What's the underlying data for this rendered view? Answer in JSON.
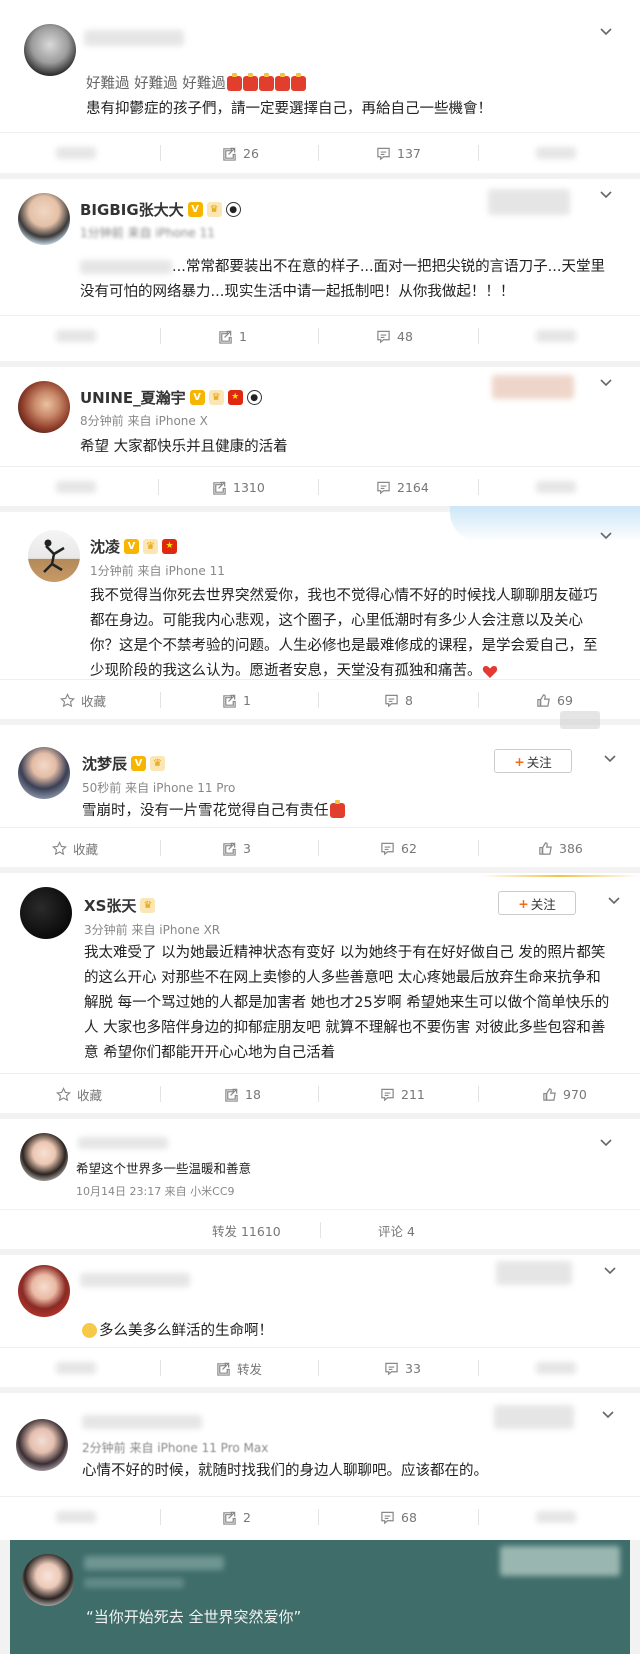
{
  "colors": {
    "accent": "#e86b0a",
    "follow_plus": "#f56b0d",
    "footer_bg": "#3e6d6a",
    "heart": "#e53935",
    "vip_badge": "#f7b500"
  },
  "posts": [
    {
      "text_line1": "好難過 好難過 好難過",
      "text_line2": "患有抑鬱症的孩子們，請一定要選擇自己，再給自己一些機會！",
      "repost": "26",
      "comment": "137"
    },
    {
      "name": "BIGBIG张大大",
      "meta": "1分钟前 来自 iPhone 11",
      "text": "...常常都要装出不在意的样子...面对一把把尖锐的言语刀子...天堂里没有可怕的网络暴力...现实生活中请一起抵制吧！从你我做起！！！",
      "repost": "1",
      "comment": "48"
    },
    {
      "name": "UNINE_夏瀚宇",
      "meta": "8分钟前 来自 iPhone X",
      "text": "希望 大家都快乐并且健康的活着",
      "repost": "1310",
      "comment": "2164"
    },
    {
      "name": "沈凌",
      "meta": "1分钟前 来自 iPhone 11",
      "text": "我不觉得当你死去世界突然爱你，我也不觉得心情不好的时候找人聊聊朋友碰巧都在身边。可能我内心悲观，这个圈子，心里低潮时有多少人会注意以及关心你？这是个不禁考验的问题。人生必修也是最难修成的课程，是学会爱自己，至少现阶段的我这么认为。愿逝者安息，天堂没有孤独和痛苦。",
      "fav": "收藏",
      "repost": "1",
      "comment": "8",
      "like": "69"
    },
    {
      "name": "沈梦辰",
      "meta": "50秒前 来自 iPhone 11 Pro",
      "text": "雪崩时，没有一片雪花觉得自己有责任",
      "follow": "关注",
      "fav": "收藏",
      "repost": "3",
      "comment": "62",
      "like": "386"
    },
    {
      "name": "XS张天",
      "meta": "3分钟前 来自 iPhone XR",
      "text": "我太难受了 以为她最近精神状态有变好 以为她终于有在好好做自己 发的照片都笑的这么开心 对那些不在网上卖惨的人多些善意吧 太心疼她最后放弃生命来抗争和解脱 每一个骂过她的人都是加害者 她也才25岁啊 希望她来生可以做个简单快乐的人 大家也多陪伴身边的抑郁症朋友吧 就算不理解也不要伤害 对彼此多些包容和善意 希望你们都能开开心心地为自己活着",
      "follow": "关注",
      "fav": "收藏",
      "repost": "18",
      "comment": "211",
      "like": "970"
    },
    {
      "text": "希望这个世界多一些温暖和善意",
      "meta": "10月14日 23:17 来自 小米CC9",
      "repost": "转发 11610",
      "comment": "评论 4"
    },
    {
      "text": "多么美多么鲜活的生命啊！",
      "repost": "转发",
      "comment": "33"
    },
    {
      "meta": "2分钟前 来自 iPhone 11 Pro Max",
      "text": "心情不好的时候，就随时找我们的身边人聊聊吧。应该都在的。",
      "repost": "2",
      "comment": "68"
    }
  ],
  "footer": {
    "caption": "“当你开始死去 全世界突然爱你”"
  },
  "icons": {
    "chevron": "chevron-down-icon",
    "repost": "repost-icon",
    "comment": "comment-icon",
    "like": "like-icon",
    "star": "star-icon",
    "heart": "heart-icon"
  }
}
